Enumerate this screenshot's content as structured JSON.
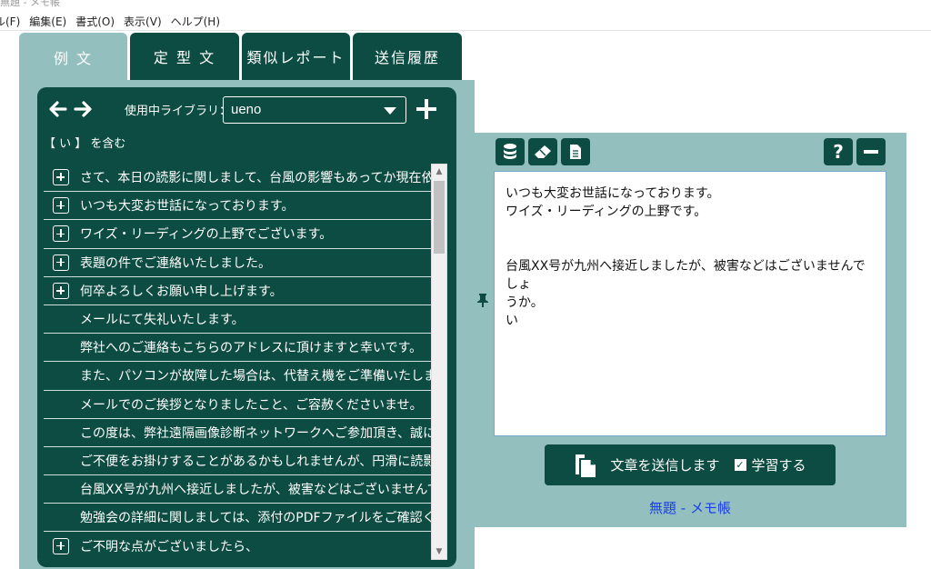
{
  "notepad": {
    "title": "無題 - メモ帳",
    "menu": [
      "ル(F)",
      "編集(E)",
      "書式(O)",
      "表示(V)",
      "ヘルプ(H)"
    ]
  },
  "tabs": [
    "例 文",
    "定 型 文",
    "類似レポート",
    "送信履歴"
  ],
  "library": {
    "label": "使用中ライブラリ：",
    "selected": "ueno",
    "filter_label": "【 い 】 を含む"
  },
  "phrases": [
    {
      "text": "さて、本日の読影に関しまして、台風の影響もあってか現在依",
      "expandable": true
    },
    {
      "text": "いつも大変お世話になっております。",
      "expandable": true
    },
    {
      "text": "ワイズ・リーディングの上野でございます。",
      "expandable": true
    },
    {
      "text": "表題の件でご連絡いたしました。",
      "expandable": true
    },
    {
      "text": "何卒よろしくお願い申し上げます。",
      "expandable": true
    },
    {
      "text": "メールにて失礼いたします。",
      "expandable": false
    },
    {
      "text": "弊社へのご連絡もこちらのアドレスに頂けますと幸いです。",
      "expandable": false
    },
    {
      "text": "また、パソコンが故障した場合は、代替え機をご準備いたします",
      "expandable": false
    },
    {
      "text": "メールでのご挨拶となりましたこと、ご容赦くださいませ。",
      "expandable": false
    },
    {
      "text": "この度は、弊社遠隔画像診断ネットワークへご参加頂き、誠に",
      "expandable": false
    },
    {
      "text": "ご不便をお掛けすることがあるかもしれませんが、円滑に読影頂",
      "expandable": false
    },
    {
      "text": "台風XX号が九州へ接近しましたが、被害などはございませんで",
      "expandable": false
    },
    {
      "text": "勉強会の詳細に関しましては、添付のPDFファイルをご確認く",
      "expandable": false
    },
    {
      "text": "ご不明な点がございましたら、",
      "expandable": true
    }
  ],
  "editor": {
    "lines": [
      "いつも大変お世話になっております。",
      "ワイズ・リーディングの上野です。",
      "",
      "",
      "台風XX号が九州へ接近しましたが、被害などはございませんでしょ",
      "うか。",
      "い"
    ]
  },
  "send": {
    "label": "文章を送信します",
    "learn_label": "学習する",
    "learn_checked": true
  },
  "target_window": "無題 - メモ帳",
  "colors": {
    "dark_green": "#0d4c42",
    "panel_teal": "#93bfbe",
    "link_blue": "#1a3ee8"
  }
}
